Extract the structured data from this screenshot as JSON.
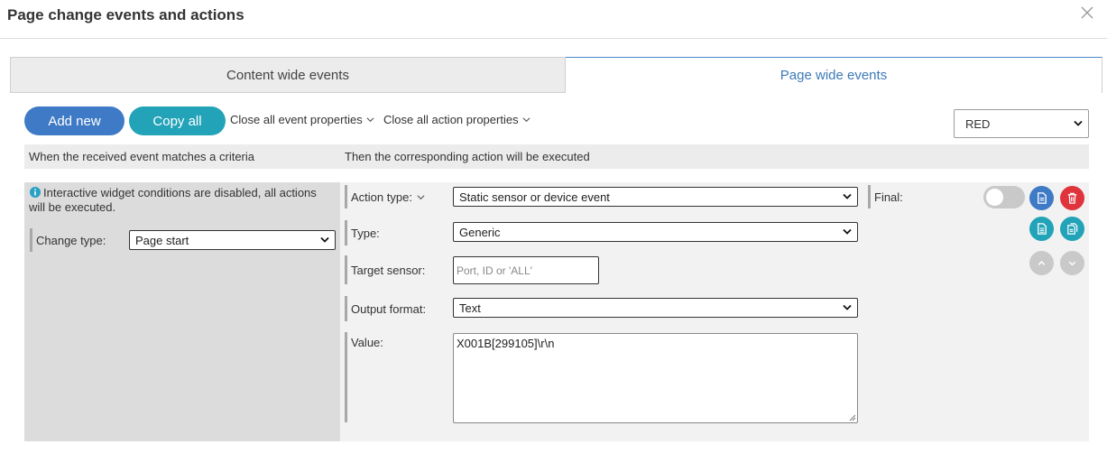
{
  "dialog": {
    "title": "Page change events and actions"
  },
  "tabs": [
    {
      "label": "Content wide events"
    },
    {
      "label": "Page wide events"
    }
  ],
  "toolbar": {
    "add_new": "Add new",
    "copy_all": "Copy all",
    "close_event_props": "Close all event properties",
    "close_action_props": "Close all action properties",
    "color_select": "RED"
  },
  "headers": {
    "criteria": "When the received event matches a criteria",
    "action": "Then the corresponding action will be executed"
  },
  "condition": {
    "info": "Interactive widget conditions are disabled, all actions will be executed.",
    "change_type_label": "Change type:",
    "change_type_value": "Page start"
  },
  "action": {
    "action_type_label": "Action type:",
    "action_type_value": "Static sensor or device event",
    "type_label": "Type:",
    "type_value": "Generic",
    "target_label": "Target sensor:",
    "target_placeholder": "Port, ID or 'ALL'",
    "output_label": "Output format:",
    "output_value": "Text",
    "value_label": "Value:",
    "value_text": "X001B[299105]\\r\\n",
    "final_label": "Final:"
  },
  "colors": {
    "primary_blue": "#3f7ac6",
    "teal": "#22a3b8",
    "delete_red": "#e0343c",
    "tab_active_text": "#3d7ab8"
  },
  "icons": {
    "close": "close-icon",
    "info": "info-icon",
    "chevron": "chevron-down-icon",
    "copy": "copy-icon",
    "delete": "trash-icon",
    "document": "document-icon",
    "paste": "paste-icon",
    "move_up": "arrow-up-icon",
    "move_down": "arrow-down-icon"
  }
}
